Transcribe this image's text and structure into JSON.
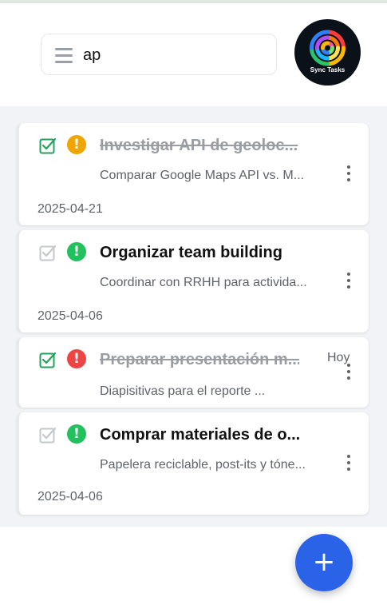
{
  "search": {
    "value": "ap",
    "placeholder": ""
  },
  "logo": {
    "text": "Sync Tasks"
  },
  "tasks": [
    {
      "title": "Investigar API de geoloc...",
      "description": "Comparar Google Maps API vs. M...",
      "date": "2025-04-21",
      "completed": true,
      "priority": "medium",
      "priority_color": "#f0a500"
    },
    {
      "title": "Organizar team building",
      "description": "Coordinar con RRHH para activida...",
      "date": "2025-04-06",
      "completed": false,
      "priority": "low",
      "priority_color": "#22c15e"
    },
    {
      "title": "Preparar presentación m...",
      "description": "Diapisitivas para el reporte ...",
      "date": "Hoy",
      "completed": true,
      "priority": "high",
      "priority_color": "#ef4444"
    },
    {
      "title": "Comprar materiales de o...",
      "description": "Papelera reciclable, post-its y tóne...",
      "date": "2025-04-06",
      "completed": false,
      "priority": "low",
      "priority_color": "#22c15e"
    }
  ],
  "fab": {
    "icon": "plus-icon",
    "label": "+"
  },
  "colors": {
    "accent": "#2b63e8",
    "check_done": "#22a35a",
    "check_pending": "#c4c7cc",
    "list_background": "#f1f3f6"
  }
}
